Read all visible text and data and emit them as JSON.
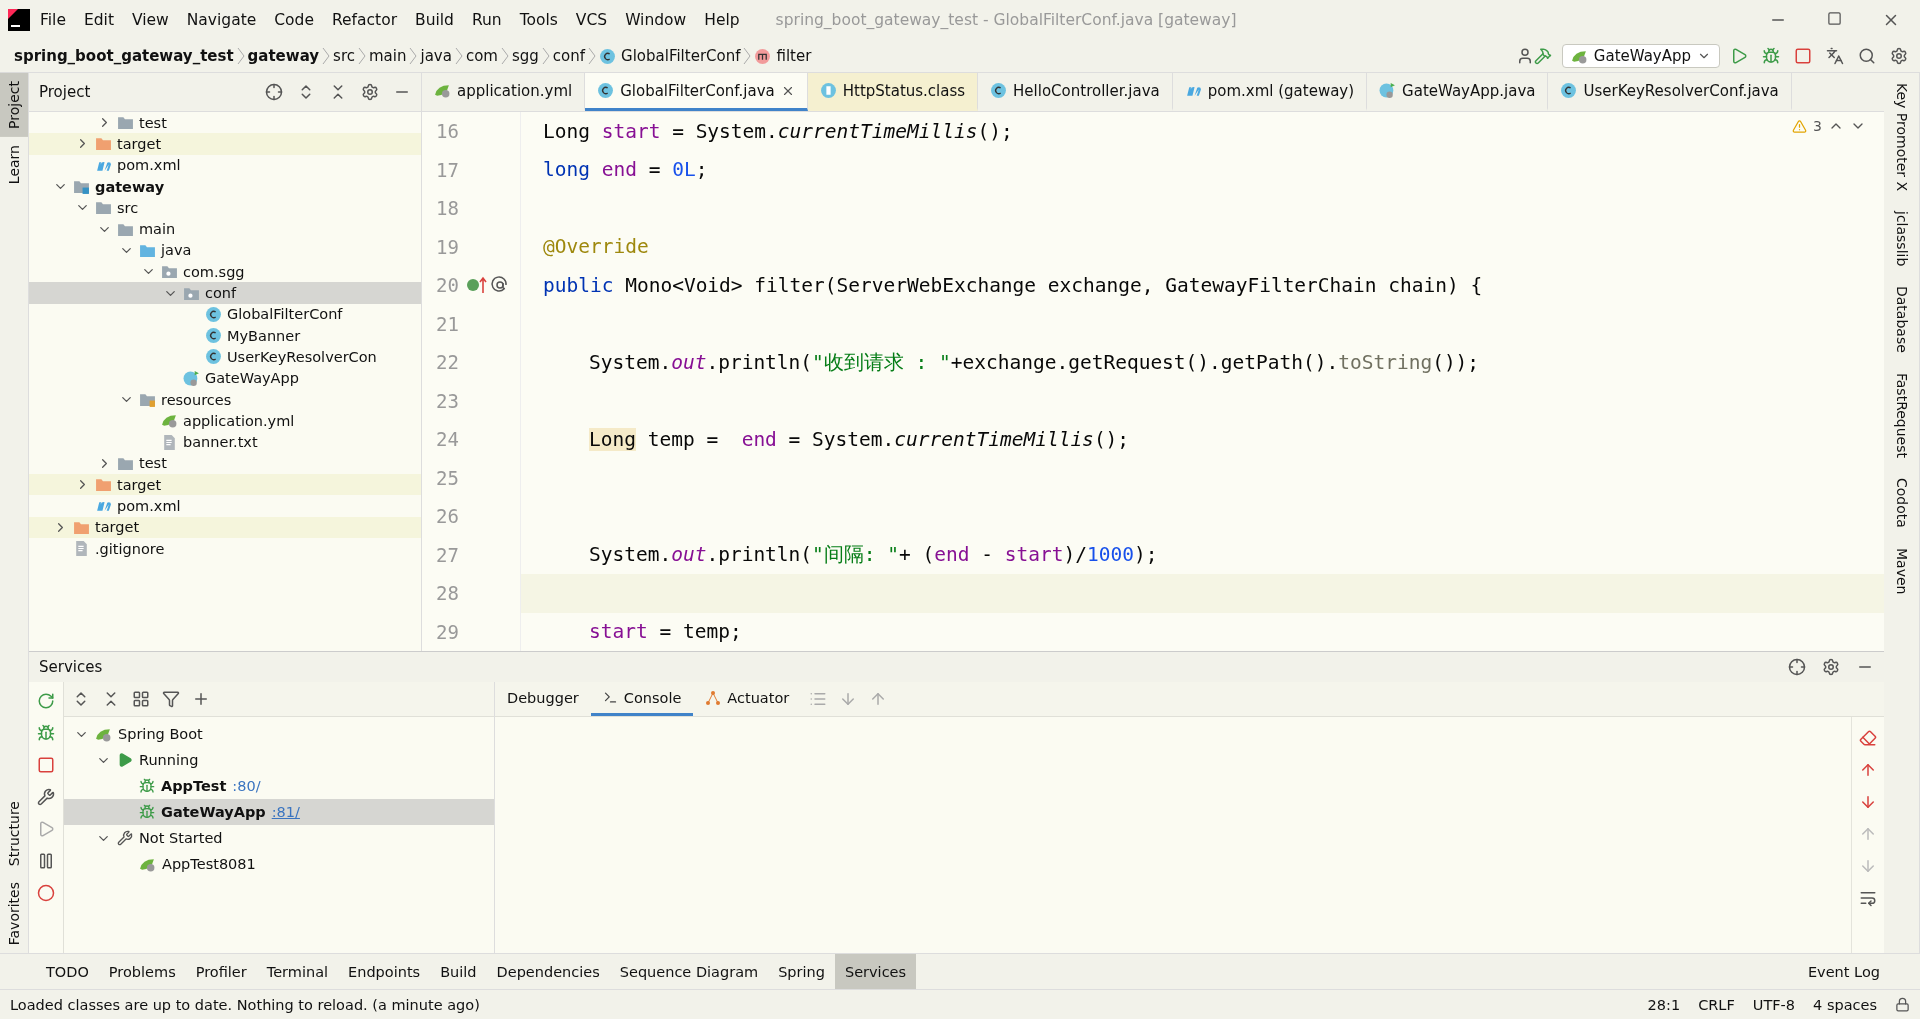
{
  "window": {
    "title": "spring_boot_gateway_test - GlobalFilterConf.java [gateway]"
  },
  "menu": [
    "File",
    "Edit",
    "View",
    "Navigate",
    "Code",
    "Refactor",
    "Build",
    "Run",
    "Tools",
    "VCS",
    "Window",
    "Help"
  ],
  "breadcrumbs": [
    {
      "label": "spring_boot_gateway_test",
      "kind": "project"
    },
    {
      "label": "gateway",
      "kind": "project"
    },
    {
      "label": "src",
      "kind": "dir"
    },
    {
      "label": "main",
      "kind": "dir"
    },
    {
      "label": "java",
      "kind": "dir"
    },
    {
      "label": "com",
      "kind": "dir"
    },
    {
      "label": "sgg",
      "kind": "dir"
    },
    {
      "label": "conf",
      "kind": "dir"
    },
    {
      "label": "GlobalFilterConf",
      "kind": "class"
    },
    {
      "label": "filter",
      "kind": "method"
    }
  ],
  "run_config": {
    "label": "GateWayApp"
  },
  "left_strip": [
    {
      "label": "Project",
      "selected": true
    },
    {
      "label": "Learn",
      "selected": false
    }
  ],
  "left_strip_bottom": [
    {
      "label": "Structure",
      "selected": false
    },
    {
      "label": "Favorites",
      "selected": false
    }
  ],
  "right_strip": [
    "Key Promoter X",
    "jclasslib",
    "Database",
    "FastRequest",
    "Codota",
    "Maven"
  ],
  "project": {
    "title": "Project",
    "tree": [
      {
        "kind": "hidden",
        "children": [
          {
            "kind": "hidden",
            "children": [
              {
                "label": "test",
                "kind": "folder",
                "expanded": false,
                "selected": false
              }
            ]
          },
          {
            "label": "target",
            "kind": "excluded",
            "expanded": false,
            "selected": false
          },
          {
            "label": "pom.xml",
            "kind": "maven",
            "selected": false
          }
        ]
      },
      {
        "label": "gateway",
        "kind": "module",
        "expanded": true,
        "selected": false,
        "children": [
          {
            "label": "src",
            "kind": "folder",
            "expanded": true,
            "selected": false,
            "children": [
              {
                "label": "main",
                "kind": "folder",
                "expanded": true,
                "selected": false,
                "children": [
                  {
                    "label": "java",
                    "kind": "source",
                    "expanded": true,
                    "selected": false,
                    "children": [
                      {
                        "label": "com.sgg",
                        "kind": "package",
                        "expanded": true,
                        "selected": false,
                        "children": [
                          {
                            "label": "conf",
                            "kind": "package",
                            "expanded": true,
                            "selected": true,
                            "children": [
                              {
                                "label": "GlobalFilterConf",
                                "kind": "class",
                                "selected": false
                              },
                              {
                                "label": "MyBanner",
                                "kind": "class",
                                "selected": false
                              },
                              {
                                "label": "UserKeyResolverCon",
                                "kind": "class",
                                "selected": false
                              }
                            ]
                          },
                          {
                            "label": "GateWayApp",
                            "kind": "app",
                            "selected": false
                          }
                        ]
                      }
                    ]
                  },
                  {
                    "label": "resources",
                    "kind": "resources",
                    "expanded": true,
                    "selected": false,
                    "children": [
                      {
                        "label": "application.yml",
                        "kind": "spring",
                        "selected": false
                      },
                      {
                        "label": "banner.txt",
                        "kind": "text",
                        "selected": false
                      }
                    ]
                  }
                ]
              },
              {
                "label": "test",
                "kind": "folder",
                "expanded": false,
                "selected": false
              }
            ]
          },
          {
            "label": "target",
            "kind": "excluded",
            "expanded": false,
            "selected": false
          },
          {
            "label": "pom.xml",
            "kind": "maven",
            "selected": false
          }
        ]
      },
      {
        "label": "target",
        "kind": "excluded",
        "expanded": false,
        "selected": false
      },
      {
        "label": ".gitignore",
        "kind": "text",
        "selected": false
      }
    ]
  },
  "tabs": [
    {
      "label": "application.yml",
      "kind": "spring",
      "selected": false
    },
    {
      "label": "GlobalFilterConf.java",
      "kind": "class",
      "selected": true
    },
    {
      "label": "HttpStatus.class",
      "kind": "binary",
      "selected": false
    },
    {
      "label": "HelloController.java",
      "kind": "class",
      "selected": false
    },
    {
      "label": "pom.xml (gateway)",
      "kind": "maven",
      "selected": false
    },
    {
      "label": "GateWayApp.java",
      "kind": "app",
      "selected": false
    },
    {
      "label": "UserKeyResolverConf.java",
      "kind": "class",
      "selected": false
    }
  ],
  "editor": {
    "warnings": "3",
    "lines": [
      {
        "number": "16",
        "kind": "member",
        "tokens": [
          {
            "kind": "plain",
            "text": "Long "
          },
          {
            "kind": "var",
            "text": "start"
          },
          {
            "kind": "plain",
            "text": " = System."
          },
          {
            "kind": "static",
            "text": "currentTimeMillis"
          },
          {
            "kind": "plain",
            "text": "();"
          }
        ]
      },
      {
        "number": "17",
        "kind": "member",
        "tokens": [
          {
            "kind": "keyword",
            "text": "long "
          },
          {
            "kind": "var",
            "text": "end"
          },
          {
            "kind": "plain",
            "text": " = "
          },
          {
            "kind": "number",
            "text": "0L"
          },
          {
            "kind": "plain",
            "text": ";"
          }
        ]
      },
      {
        "number": "18",
        "kind": "blank"
      },
      {
        "number": "19",
        "kind": "member",
        "tokens": [
          {
            "kind": "annotation",
            "text": "@Override"
          }
        ]
      },
      {
        "number": "20",
        "kind": "member",
        "marker": true,
        "tokens": [
          {
            "kind": "keyword",
            "text": "public "
          },
          {
            "kind": "plain",
            "text": "Mono<Void> filter(ServerWebExchange exchange, GatewayFilterChain chain) {"
          }
        ]
      },
      {
        "number": "21",
        "kind": "blank"
      },
      {
        "number": "22",
        "kind": "body",
        "tokens": [
          {
            "kind": "plain",
            "text": "System."
          },
          {
            "kind": "field",
            "text": "out"
          },
          {
            "kind": "plain",
            "text": ".println("
          },
          {
            "kind": "string",
            "text": "\"收到请求 : \""
          },
          {
            "kind": "plain",
            "text": "+exchange.getRequest().getPath()."
          },
          {
            "kind": "dim",
            "text": "toString"
          },
          {
            "kind": "plain",
            "text": "());"
          }
        ]
      },
      {
        "number": "23",
        "kind": "blank"
      },
      {
        "number": "24",
        "kind": "body",
        "tokens": [
          {
            "kind": "highlight",
            "text": "Long"
          },
          {
            "kind": "plain",
            "text": " temp =  "
          },
          {
            "kind": "var",
            "text": "end"
          },
          {
            "kind": "plain",
            "text": " = System."
          },
          {
            "kind": "static",
            "text": "currentTimeMillis"
          },
          {
            "kind": "plain",
            "text": "();"
          }
        ]
      },
      {
        "number": "25",
        "kind": "blank"
      },
      {
        "number": "26",
        "kind": "blank"
      },
      {
        "number": "27",
        "kind": "body",
        "tokens": [
          {
            "kind": "plain",
            "text": "System."
          },
          {
            "kind": "field",
            "text": "out"
          },
          {
            "kind": "plain",
            "text": ".println("
          },
          {
            "kind": "string",
            "text": "\"间隔: \""
          },
          {
            "kind": "plain",
            "text": "+ ("
          },
          {
            "kind": "var",
            "text": "end"
          },
          {
            "kind": "plain",
            "text": " - "
          },
          {
            "kind": "var",
            "text": "start"
          },
          {
            "kind": "plain",
            "text": ")/"
          },
          {
            "kind": "number",
            "text": "1000"
          },
          {
            "kind": "plain",
            "text": ");"
          }
        ]
      },
      {
        "number": "28",
        "kind": "current"
      },
      {
        "number": "29",
        "kind": "body",
        "tokens": [
          {
            "kind": "var",
            "text": "start"
          },
          {
            "kind": "plain",
            "text": " = temp;"
          }
        ]
      }
    ]
  },
  "services": {
    "title": "Services",
    "tree": [
      {
        "label": "Spring Boot",
        "kind": "spring",
        "expanded": true,
        "selected": false,
        "children": [
          {
            "label": "Running",
            "kind": "running",
            "expanded": true,
            "selected": false,
            "children": [
              {
                "label": "AppTest",
                "port": ":80/",
                "kind": "app",
                "selected": false
              },
              {
                "label": "GateWayApp",
                "port": ":81/",
                "kind": "app",
                "selected": true
              }
            ]
          },
          {
            "label": "Not Started",
            "kind": "stopped",
            "expanded": true,
            "selected": false,
            "children": [
              {
                "label": "AppTest8081",
                "kind": "idle",
                "selected": false
              }
            ]
          }
        ]
      }
    ],
    "tabs": [
      {
        "label": "Debugger",
        "kind": "plain",
        "selected": false
      },
      {
        "label": "Console",
        "kind": "console",
        "selected": true
      },
      {
        "label": "Actuator",
        "kind": "actuator",
        "selected": false
      }
    ]
  },
  "tool_tabs": [
    {
      "label": "TODO",
      "selected": false
    },
    {
      "label": "Problems",
      "selected": false
    },
    {
      "label": "Profiler",
      "selected": false
    },
    {
      "label": "Terminal",
      "selected": false
    },
    {
      "label": "Endpoints",
      "selected": false
    },
    {
      "label": "Build",
      "selected": false
    },
    {
      "label": "Dependencies",
      "selected": false
    },
    {
      "label": "Sequence Diagram",
      "selected": false
    },
    {
      "label": "Spring",
      "selected": false
    },
    {
      "label": "Services",
      "selected": true
    }
  ],
  "event_log": "Event Log",
  "status_bar": {
    "message": "Loaded classes are up to date. Nothing to reload. (a minute ago)",
    "items": [
      "28:1",
      "CRLF",
      "UTF-8",
      "4 spaces"
    ]
  }
}
